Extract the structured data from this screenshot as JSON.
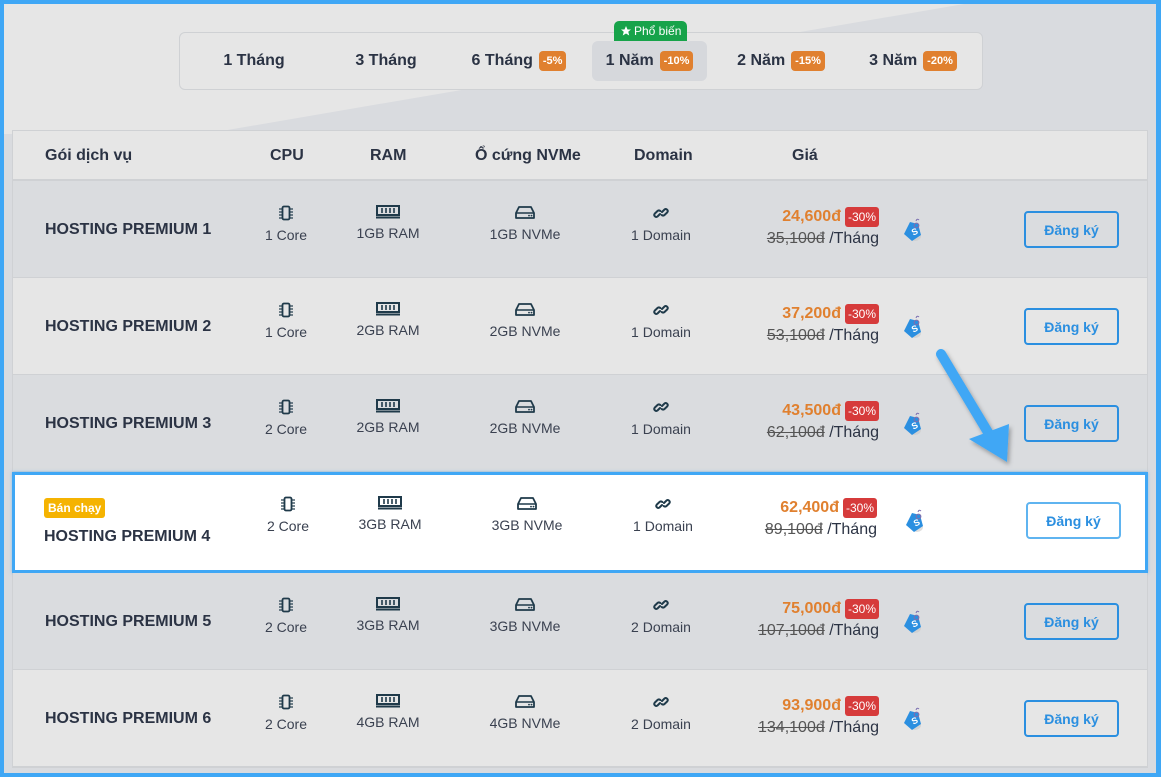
{
  "period_tabs": {
    "items": [
      {
        "label": "1 Tháng",
        "discount": null
      },
      {
        "label": "3 Tháng",
        "discount": null
      },
      {
        "label": "6 Tháng",
        "discount": "-5%"
      },
      {
        "label": "1 Năm",
        "discount": "-10%",
        "active": true,
        "ribbon": "Phổ biến"
      },
      {
        "label": "2 Năm",
        "discount": "-15%"
      },
      {
        "label": "3 Năm",
        "discount": "-20%"
      }
    ]
  },
  "table": {
    "headers": {
      "package": "Gói dịch vụ",
      "cpu": "CPU",
      "ram": "RAM",
      "disk": "Ổ cứng NVMe",
      "domain": "Domain",
      "price": "Giá"
    },
    "register_label": "Đăng ký",
    "per_unit": "/Tháng",
    "rows": [
      {
        "name": "HOSTING PREMIUM 1",
        "badge": null,
        "cpu": "1 Core",
        "ram": "1GB RAM",
        "disk": "1GB NVMe",
        "domain": "1 Domain",
        "price": "24,600đ",
        "discount": "-30%",
        "old_price": "35,100đ"
      },
      {
        "name": "HOSTING PREMIUM 2",
        "badge": null,
        "cpu": "1 Core",
        "ram": "2GB RAM",
        "disk": "2GB NVMe",
        "domain": "1 Domain",
        "price": "37,200đ",
        "discount": "-30%",
        "old_price": "53,100đ"
      },
      {
        "name": "HOSTING PREMIUM 3",
        "badge": null,
        "cpu": "2 Core",
        "ram": "2GB RAM",
        "disk": "2GB NVMe",
        "domain": "1 Domain",
        "price": "43,500đ",
        "discount": "-30%",
        "old_price": "62,100đ"
      },
      {
        "name": "HOSTING PREMIUM 4",
        "badge": "Bán chạy",
        "cpu": "2 Core",
        "ram": "3GB RAM",
        "disk": "3GB NVMe",
        "domain": "1 Domain",
        "price": "62,400đ",
        "discount": "-30%",
        "old_price": "89,100đ",
        "featured": true
      },
      {
        "name": "HOSTING PREMIUM 5",
        "badge": null,
        "cpu": "2 Core",
        "ram": "3GB RAM",
        "disk": "3GB NVMe",
        "domain": "2 Domain",
        "price": "75,000đ",
        "discount": "-30%",
        "old_price": "107,100đ"
      },
      {
        "name": "HOSTING PREMIUM 6",
        "badge": null,
        "cpu": "2 Core",
        "ram": "4GB RAM",
        "disk": "4GB NVMe",
        "domain": "2 Domain",
        "price": "93,900đ",
        "discount": "-30%",
        "old_price": "134,100đ"
      }
    ]
  },
  "colors": {
    "accent_blue": "#2b8fe0",
    "price_orange": "#e0802f",
    "discount_red": "#d63b3b",
    "popular_green": "#17a34a",
    "hot_yellow": "#f5b301"
  }
}
